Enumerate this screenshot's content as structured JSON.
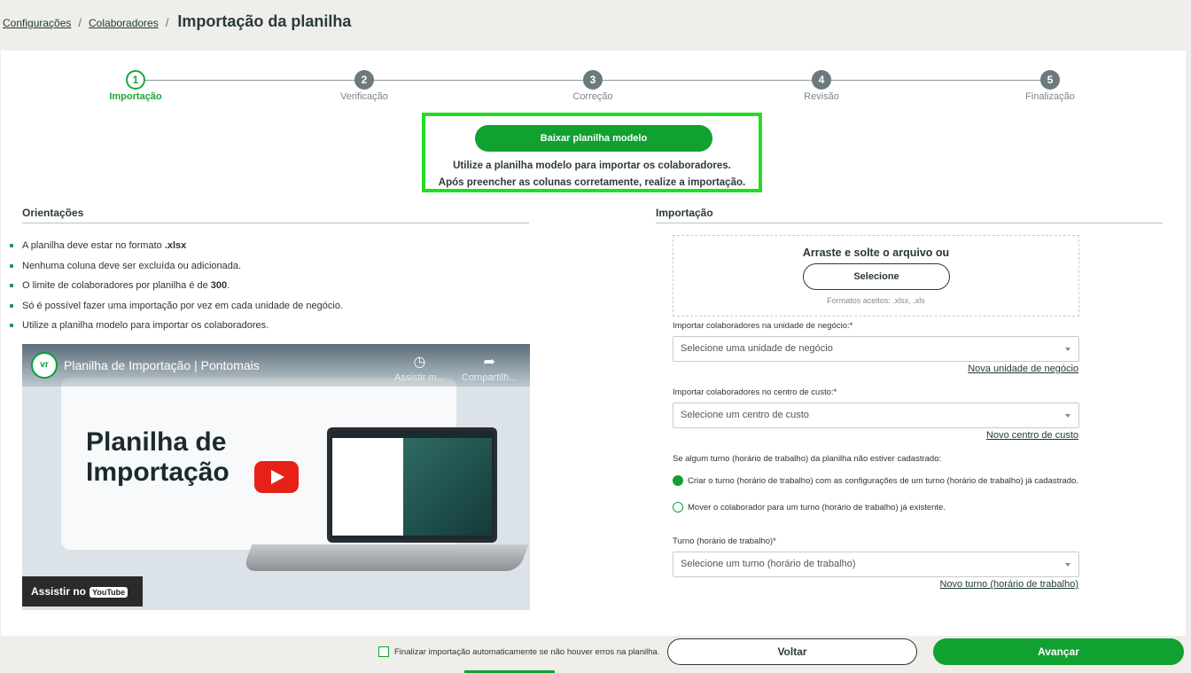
{
  "breadcrumb": {
    "items": [
      "Configurações",
      "Colaboradores"
    ],
    "current": "Importação da planilha"
  },
  "stepper": {
    "steps": [
      {
        "number": "1",
        "label": "Importação",
        "active": true
      },
      {
        "number": "2",
        "label": "Verificação",
        "active": false
      },
      {
        "number": "3",
        "label": "Correção",
        "active": false
      },
      {
        "number": "4",
        "label": "Revisão",
        "active": false
      },
      {
        "number": "5",
        "label": "Finalização",
        "active": false
      }
    ]
  },
  "template_download": {
    "button_label": "Baixar planilha modelo",
    "line1": "Utilize a planilha modelo para importar os colaboradores.",
    "line2": "Após preencher as colunas corretamente, realize a importação."
  },
  "orientations": {
    "title": "Orientações",
    "items": [
      {
        "text": "A planilha deve estar no formato ",
        "bold": ".xlsx",
        "after": ""
      },
      {
        "text": "Nenhuma coluna deve ser excluída ou adicionada.",
        "bold": "",
        "after": ""
      },
      {
        "text": "O limite de colaboradores por planilha é de ",
        "bold": "300",
        "after": "."
      },
      {
        "text": "Só é possível fazer uma importação por vez em cada unidade de negócio.",
        "bold": "",
        "after": ""
      },
      {
        "text": "Utilize a planilha modelo para importar os colaboradores.",
        "bold": "",
        "after": ""
      }
    ]
  },
  "video": {
    "channel_logo": "vr",
    "title": "Planilha de Importação | Pontomais",
    "watch_later": "Assistir m...",
    "share": "Compartilh...",
    "headline_line1": "Planilha de",
    "headline_line2": "Importação",
    "watch_on": "Assistir no",
    "youtube": "YouTube"
  },
  "import": {
    "title": "Importação",
    "dropzone_title": "Arraste e solte o arquivo ou",
    "select_button": "Selecione",
    "formats": "Formatos aceitos: .xlsx, .xls",
    "unit_label": "Importar colaboradores na unidade de negócio:*",
    "unit_placeholder": "Selecione uma unidade de negócio",
    "unit_new": "Nova unidade de negócio",
    "cost_label": "Importar colaboradores no centro de custo:*",
    "cost_placeholder": "Selecione um centro de custo",
    "cost_new": "Novo centro de custo",
    "shift_question": "Se algum turno (horário de trabalho) da planilha não estiver cadastrado:",
    "radio_create": "Criar o turno (horário de trabalho) com as configurações de um turno (horário de trabalho) já cadastrado.",
    "radio_move": "Mover o colaborador para um turno (horário de trabalho) já existente.",
    "shift_label": "Turno (horário de trabalho)*",
    "shift_placeholder": "Selecione um turno (horário de trabalho)",
    "shift_new": "Novo turno (horário de trabalho)"
  },
  "footer": {
    "auto_finish": "Finalizar importação automaticamente se não houver erros na planilha.",
    "back": "Voltar",
    "next": "Avançar"
  },
  "colors": {
    "primary": "#10a130",
    "highlight": "#22dd22"
  }
}
